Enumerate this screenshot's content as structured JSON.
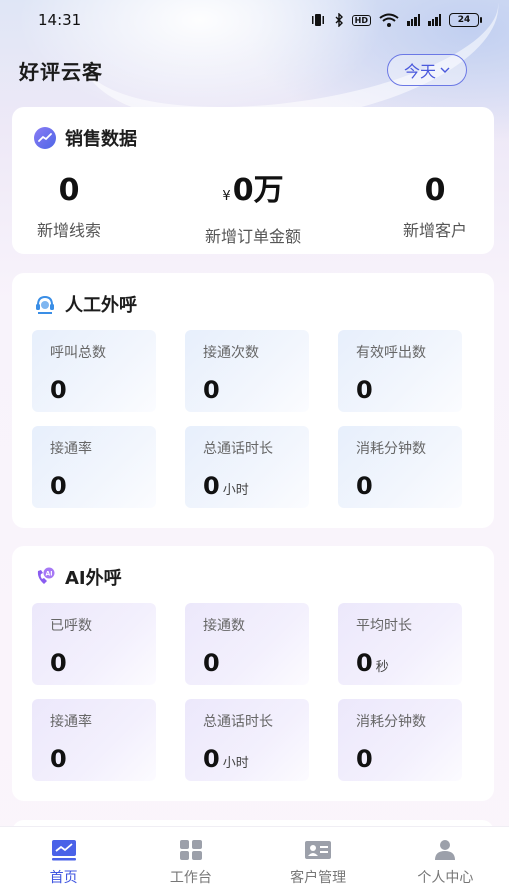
{
  "status_bar": {
    "time": "14:31",
    "hd": "HD",
    "battery": "24"
  },
  "header": {
    "title": "好评云客",
    "date_filter": "今天"
  },
  "sales": {
    "title": "销售数据",
    "stats": [
      {
        "value": "0",
        "label": "新增线索"
      },
      {
        "currency": "¥",
        "value": "0万",
        "label": "新增订单金额"
      },
      {
        "value": "0",
        "label": "新增客户"
      }
    ]
  },
  "manual_call": {
    "title": "人工外呼",
    "tiles": [
      {
        "label": "呼叫总数",
        "value": "0"
      },
      {
        "label": "接通次数",
        "value": "0"
      },
      {
        "label": "有效呼出数",
        "value": "0"
      },
      {
        "label": "接通率",
        "value": "0"
      },
      {
        "label": "总通话时长",
        "value": "0",
        "unit": "小时"
      },
      {
        "label": "消耗分钟数",
        "value": "0"
      }
    ]
  },
  "ai_call": {
    "title": "AI外呼",
    "tiles": [
      {
        "label": "已呼数",
        "value": "0"
      },
      {
        "label": "接通数",
        "value": "0"
      },
      {
        "label": "平均时长",
        "value": "0",
        "unit": "秒"
      },
      {
        "label": "接通率",
        "value": "0"
      },
      {
        "label": "总通话时长",
        "value": "0",
        "unit": "小时"
      },
      {
        "label": "消耗分钟数",
        "value": "0"
      }
    ]
  },
  "tabbar": {
    "items": [
      {
        "label": "首页",
        "icon": "chart-icon",
        "active": true
      },
      {
        "label": "工作台",
        "icon": "grid-icon",
        "active": false
      },
      {
        "label": "客户管理",
        "icon": "id-card-icon",
        "active": false
      },
      {
        "label": "个人中心",
        "icon": "person-icon",
        "active": false
      }
    ]
  },
  "colors": {
    "accent": "#3f55e0",
    "icon_gray": "#9ca0aa"
  }
}
